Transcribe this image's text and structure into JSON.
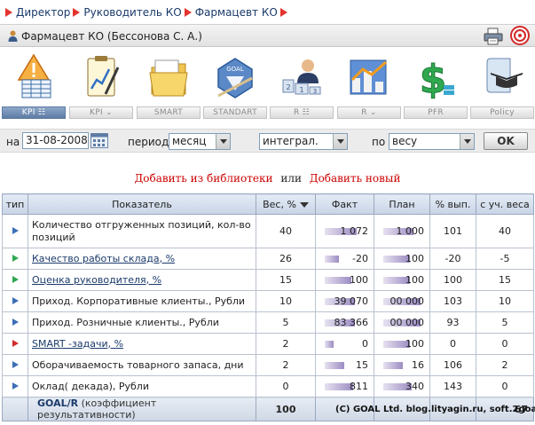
{
  "breadcrumb": [
    "Директор",
    "Руководитель КО",
    "Фармацевт КО"
  ],
  "user": {
    "name": "Фармацевт КО  (Бессонова С. А.)"
  },
  "toolbar": [
    {
      "label": "KPI ☷",
      "icon": "kpi-table-icon",
      "active": true
    },
    {
      "label": "KPI ⌄",
      "icon": "kpi-chart-icon",
      "active": false
    },
    {
      "label": "SMART",
      "icon": "smart-folder-icon",
      "active": false
    },
    {
      "label": "STANDART",
      "icon": "goal-standard-icon",
      "active": false
    },
    {
      "label": "R ☷",
      "icon": "ranking-table-icon",
      "active": false
    },
    {
      "label": "R ⌄",
      "icon": "ranking-chart-icon",
      "active": false
    },
    {
      "label": "PFR",
      "icon": "dollar-icon",
      "active": false
    },
    {
      "label": "Policy",
      "icon": "graduation-cap-icon",
      "active": false
    }
  ],
  "filters": {
    "date_label": "на",
    "date_value": "31-08-2008",
    "period_label": "период",
    "period_value": "месяц",
    "mode_value": "интеграл.",
    "by_label": "по",
    "by_value": "весу",
    "ok_label": "OK"
  },
  "links": {
    "add_library": "Добавить из библиотеки",
    "or": "или",
    "add_new": "Добавить новый"
  },
  "table": {
    "headers": [
      "тип",
      "Показатель",
      "Вес, %",
      "Факт",
      "План",
      "% вып.",
      "с уч. веса"
    ],
    "rows": [
      {
        "type": "blue",
        "name": "Количество отгруженных позиций, кол-во позиций",
        "link": false,
        "weight": "40",
        "fact": "1 072",
        "plan": "1 000",
        "pct": "101",
        "weighted": "40"
      },
      {
        "type": "green",
        "name": "Качество работы склада, %",
        "link": true,
        "weight": "26",
        "fact": "-20",
        "plan": "100",
        "pct": "-20",
        "weighted": "-5"
      },
      {
        "type": "green",
        "name": "Оценка руководителя, %",
        "link": true,
        "weight": "15",
        "fact": "100",
        "plan": "100",
        "pct": "100",
        "weighted": "15"
      },
      {
        "type": "blue",
        "name": "Приход. Корпоративные клиенты., Рубли",
        "link": false,
        "weight": "10",
        "fact": "39 070",
        "plan": "00 000",
        "pct": "103",
        "weighted": "10"
      },
      {
        "type": "blue",
        "name": "Приход. Розничные клиенты., Рубли",
        "link": false,
        "weight": "5",
        "fact": "83 366",
        "plan": "00 000",
        "pct": "93",
        "weighted": "5"
      },
      {
        "type": "red",
        "name": "SMART -задачи, %",
        "link": true,
        "weight": "2",
        "fact": "0",
        "plan": "100",
        "pct": "0",
        "weighted": "0"
      },
      {
        "type": "blue",
        "name": "Оборачиваемость товарного запаса, дни",
        "link": false,
        "weight": "2",
        "fact": "15",
        "plan": "16",
        "pct": "106",
        "weighted": "2"
      },
      {
        "type": "blue",
        "name": "Оклад( декада), Рубли",
        "link": false,
        "weight": "0",
        "fact": "811",
        "plan": "340",
        "pct": "143",
        "weighted": "0"
      }
    ],
    "total": {
      "goal": "GOAL/R",
      "goal_sub": "(коэффициент результативности)",
      "weight": "100",
      "weighted": "67"
    }
  },
  "copyright": "(C) GOAL Ltd. blog.lityagin.ru, soft.2goal.biz",
  "colors": {
    "accent_red": "#e3342f",
    "header_blue": "#5e7ba4",
    "link_blue": "#1a3a6b"
  }
}
